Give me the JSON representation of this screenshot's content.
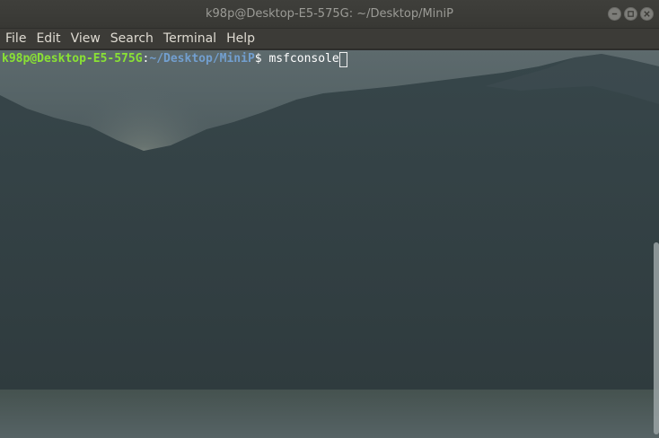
{
  "window": {
    "title": "k98p@Desktop-E5-575G: ~/Desktop/MiniP",
    "controls": [
      "minimize-icon",
      "maximize-icon",
      "close-icon"
    ]
  },
  "menubar": {
    "items": [
      "File",
      "Edit",
      "View",
      "Search",
      "Terminal",
      "Help"
    ]
  },
  "terminal": {
    "prompt_user_host": "k98p@Desktop-E5-575G",
    "prompt_colon": ":",
    "prompt_path": "~/Desktop/MiniP",
    "prompt_symbol": "$ ",
    "command": "msfconsole",
    "colors": {
      "user_host": "#8ae234",
      "path": "#729fcf",
      "text": "#ffffff"
    }
  }
}
